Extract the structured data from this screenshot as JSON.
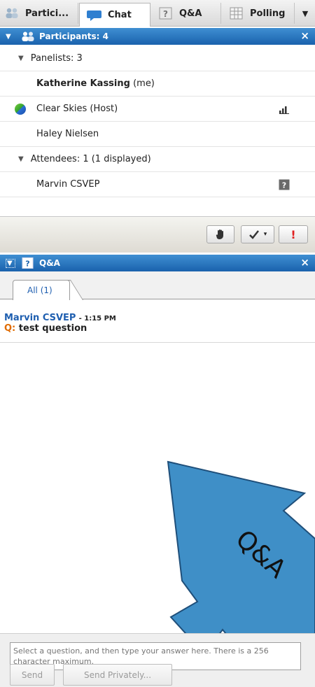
{
  "tabs": [
    {
      "label": "Partici...",
      "icon": "participants-icon"
    },
    {
      "label": "Chat",
      "icon": "chat-bubble-icon"
    },
    {
      "label": "Q&A",
      "icon": "question-icon"
    },
    {
      "label": "Polling",
      "icon": "polling-grid-icon"
    }
  ],
  "participants_panel": {
    "header": "Participants: 4",
    "panelists_label": "Panelists: 3",
    "panelists": [
      {
        "name": "Katherine Kassing",
        "suffix": "(me)"
      },
      {
        "name": "Clear Skies (Host)"
      },
      {
        "name": "Haley Nielsen"
      }
    ],
    "attendees_label": "Attendees: 1 (1 displayed)",
    "attendees": [
      {
        "name": "Marvin CSVEP"
      }
    ]
  },
  "qa_panel": {
    "header": "Q&A",
    "tab_label": "All (1)",
    "items": [
      {
        "author": "Marvin CSVEP",
        "time": "1:15 PM",
        "q_label": "Q:",
        "question": "test question"
      }
    ],
    "answer_placeholder": "Select a question, and then type your answer here. There is a 256 character maximum.",
    "send_label": "Send",
    "send_private_label": "Send Privately..."
  },
  "annotation": {
    "text": "Q&A"
  },
  "colors": {
    "header_blue": "#1a62ad",
    "link_blue": "#1f5fb0",
    "question_orange": "#e06b00",
    "arrow_fill": "#3f8fc7",
    "alert_red": "#e02020"
  }
}
